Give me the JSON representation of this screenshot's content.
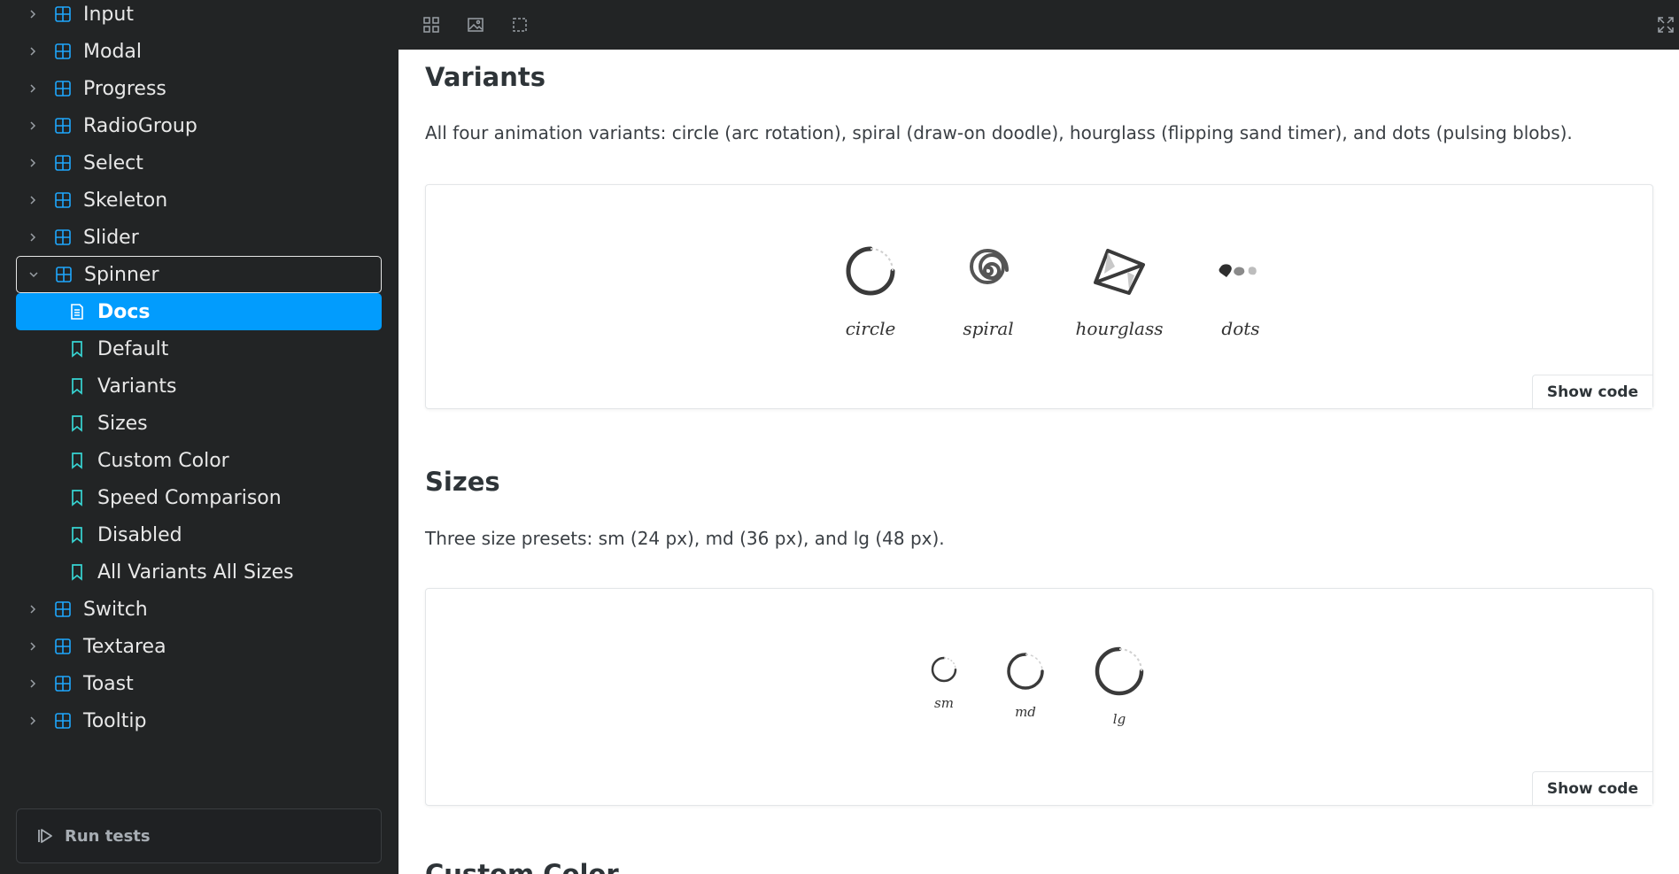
{
  "sidebar": {
    "items": [
      {
        "label": "Input",
        "kind": "component",
        "top": 0
      },
      {
        "label": "Modal",
        "kind": "component"
      },
      {
        "label": "Progress",
        "kind": "component"
      },
      {
        "label": "RadioGroup",
        "kind": "component"
      },
      {
        "label": "Select",
        "kind": "component"
      },
      {
        "label": "Skeleton",
        "kind": "component"
      },
      {
        "label": "Slider",
        "kind": "component"
      },
      {
        "label": "Spinner",
        "kind": "component",
        "expanded": true
      },
      {
        "label": "Docs",
        "kind": "docs",
        "selected": true
      },
      {
        "label": "Default",
        "kind": "story"
      },
      {
        "label": "Variants",
        "kind": "story"
      },
      {
        "label": "Sizes",
        "kind": "story"
      },
      {
        "label": "Custom Color",
        "kind": "story"
      },
      {
        "label": "Speed Comparison",
        "kind": "story"
      },
      {
        "label": "Disabled",
        "kind": "story"
      },
      {
        "label": "All Variants All Sizes",
        "kind": "story"
      },
      {
        "label": "Switch",
        "kind": "component"
      },
      {
        "label": "Textarea",
        "kind": "component"
      },
      {
        "label": "Toast",
        "kind": "component"
      },
      {
        "label": "Tooltip",
        "kind": "component"
      }
    ],
    "run_tests_label": "Run tests"
  },
  "toolbar": {
    "icons": [
      "grid-icon",
      "image-icon",
      "outline-icon",
      "fullscreen-icon"
    ]
  },
  "main": {
    "variants": {
      "title": "Variants",
      "description": "All four animation variants: circle (arc rotation), spiral (draw-on doodle), hourglass (flipping sand timer), and dots (pulsing blobs).",
      "labels": [
        "circle",
        "spiral",
        "hourglass",
        "dots"
      ],
      "show_code": "Show code"
    },
    "sizes": {
      "title": "Sizes",
      "description": "Three size presets: sm (24 px), md (36 px), and lg (48 px).",
      "labels": [
        "sm",
        "md",
        "lg"
      ],
      "show_code": "Show code"
    },
    "next_section_title": "Custom Color"
  },
  "colors": {
    "sidebar_bg": "#222425",
    "accent": "#029cfd",
    "icon_blue": "#1ea7fd",
    "story_teal": "#37d5d3"
  }
}
